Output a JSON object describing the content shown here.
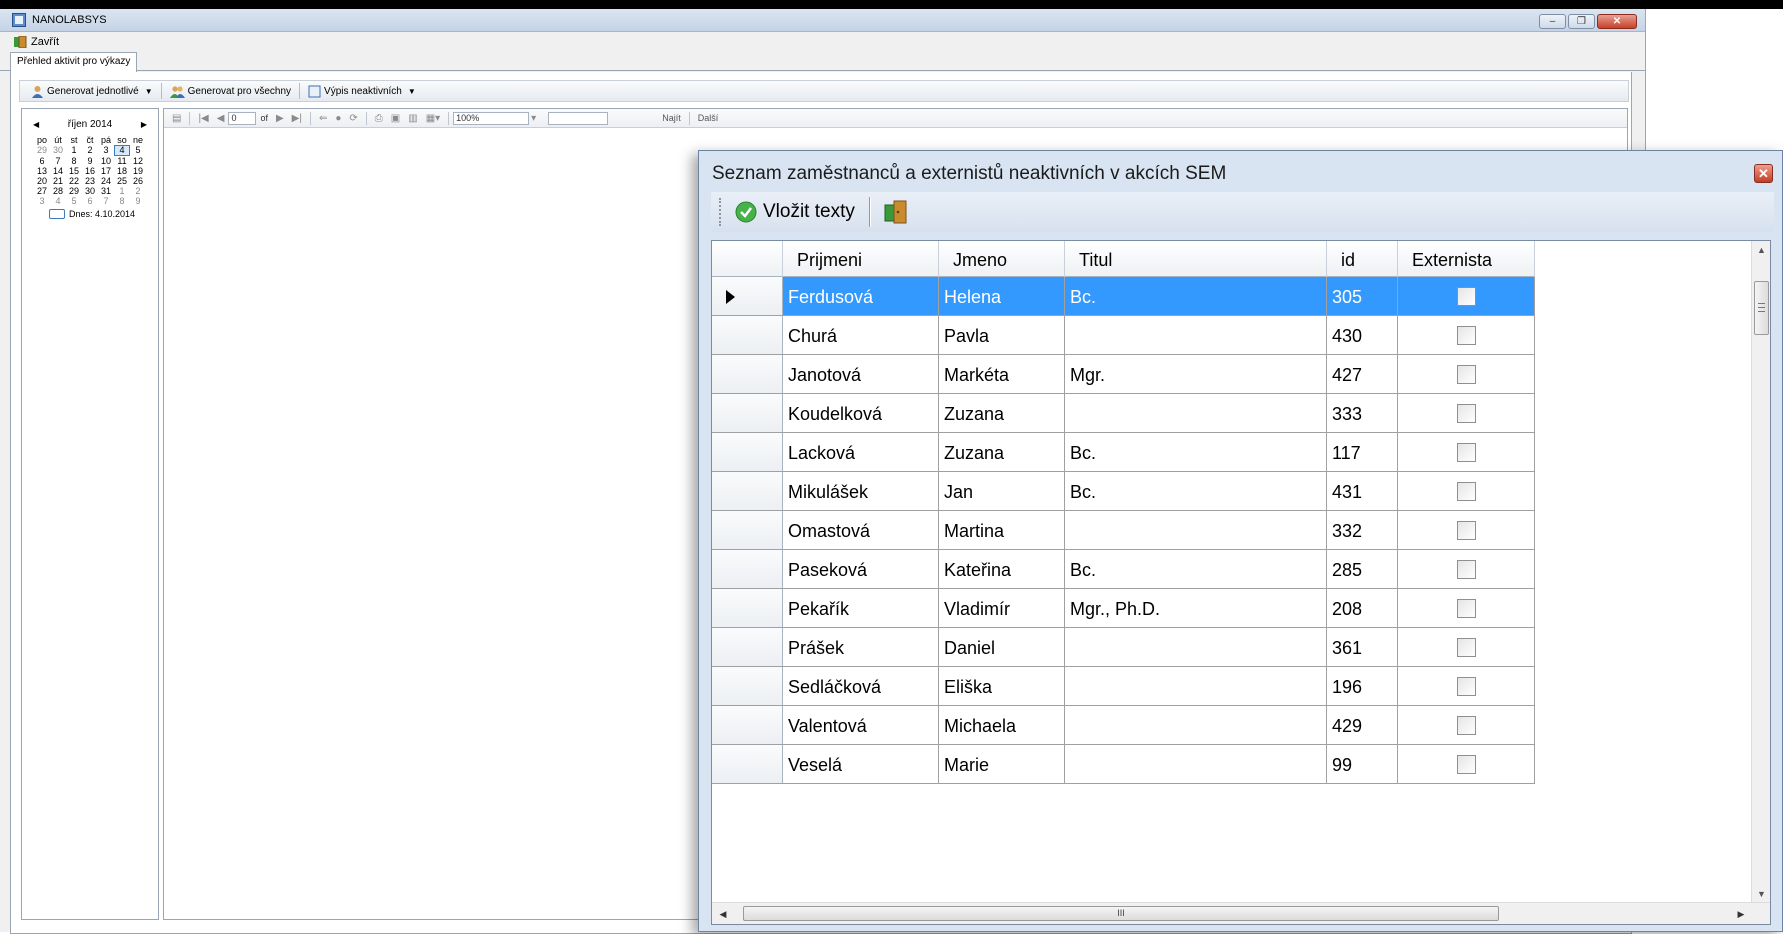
{
  "window": {
    "title": "NANOLABSYS"
  },
  "menu": {
    "close_label": "Zavřít"
  },
  "tabs": [
    {
      "label": "Přehled aktivit pro výkazy"
    }
  ],
  "toolbar": {
    "generate_individual": "Generovat jednotlivé",
    "generate_all": "Generovat pro všechny",
    "inactive_list": "Výpis neaktivních"
  },
  "calendar": {
    "month_label": "říjen 2014",
    "weekdays": [
      "po",
      "út",
      "st",
      "čt",
      "pá",
      "so",
      "ne"
    ],
    "days": [
      "29",
      "30",
      "1",
      "2",
      "3",
      "4",
      "5",
      "6",
      "7",
      "8",
      "9",
      "10",
      "11",
      "12",
      "13",
      "14",
      "15",
      "16",
      "17",
      "18",
      "19",
      "20",
      "21",
      "22",
      "23",
      "24",
      "25",
      "26",
      "27",
      "28",
      "29",
      "30",
      "31",
      "1",
      "2",
      "3",
      "4",
      "5",
      "6",
      "7",
      "8",
      "9"
    ],
    "today_label": "Dnes: 4.10.2014"
  },
  "report_viewer": {
    "page_input": "0",
    "of_label": "of",
    "zoom": "100%",
    "find_label": "Najít",
    "next_label": "Další"
  },
  "dialog": {
    "title": "Seznam zaměstnanců a externistů neaktivních v akcích SEM",
    "insert_texts_label": "Vložit texty",
    "columns": [
      "Prijmeni",
      "Jmeno",
      "Titul",
      "id",
      "Externista"
    ],
    "rows": [
      {
        "prijmeni": "Ferdusová",
        "jmeno": "Helena",
        "titul": "Bc.",
        "id": "305",
        "externista": false,
        "selected": true
      },
      {
        "prijmeni": "Churá",
        "jmeno": "Pavla",
        "titul": "",
        "id": "430",
        "externista": false
      },
      {
        "prijmeni": "Janotová",
        "jmeno": "Markéta",
        "titul": "Mgr.",
        "id": "427",
        "externista": false
      },
      {
        "prijmeni": "Koudelková",
        "jmeno": "Zuzana",
        "titul": "",
        "id": "333",
        "externista": false
      },
      {
        "prijmeni": "Lacková",
        "jmeno": "Zuzana",
        "titul": "Bc.",
        "id": "117",
        "externista": false
      },
      {
        "prijmeni": "Mikulášek",
        "jmeno": "Jan",
        "titul": "Bc.",
        "id": "431",
        "externista": false
      },
      {
        "prijmeni": "Omastová",
        "jmeno": "Martina",
        "titul": "",
        "id": "332",
        "externista": false
      },
      {
        "prijmeni": "Paseková",
        "jmeno": "Kateřina",
        "titul": "Bc.",
        "id": "285",
        "externista": false
      },
      {
        "prijmeni": "Pekařík",
        "jmeno": "Vladimír",
        "titul": "Mgr., Ph.D.",
        "id": "208",
        "externista": false
      },
      {
        "prijmeni": "Prášek",
        "jmeno": "Daniel",
        "titul": "",
        "id": "361",
        "externista": false
      },
      {
        "prijmeni": "Sedláčková",
        "jmeno": "Eliška",
        "titul": "",
        "id": "196",
        "externista": false
      },
      {
        "prijmeni": "Valentová",
        "jmeno": "Michaela",
        "titul": "",
        "id": "429",
        "externista": false
      },
      {
        "prijmeni": "Veselá",
        "jmeno": "Marie",
        "titul": "",
        "id": "99",
        "externista": false
      }
    ],
    "hscroll_thumb_label": "III"
  },
  "colors": {
    "selection": "#3399ff",
    "dialog_bg": "#d9e4f2",
    "close_red": "#c33c26"
  }
}
